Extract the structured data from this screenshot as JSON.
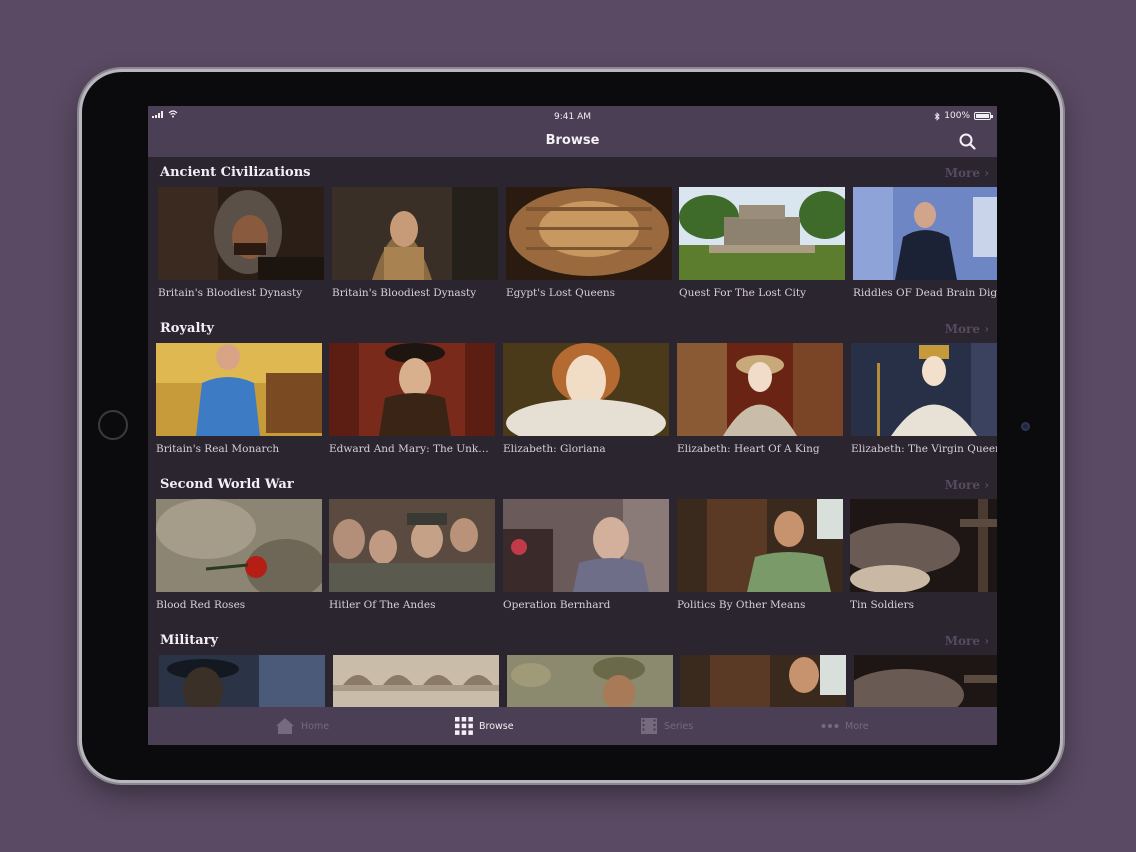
{
  "status": {
    "time": "9:41 AM",
    "battery": "100%"
  },
  "nav": {
    "title": "Browse"
  },
  "sections": [
    {
      "title": "Ancient Civilizations",
      "more": "More",
      "items": [
        "Britain's Bloodiest Dynasty",
        "Britain's Bloodiest Dynasty",
        "Egypt's Lost Queens",
        "Quest For The Lost City",
        "Riddles OF Dead Brain Digg"
      ]
    },
    {
      "title": "Royalty",
      "more": "More",
      "items": [
        "Britain's Real Monarch",
        "Edward And Mary: The Unkno...",
        "Elizabeth: Gloriana",
        "Elizabeth: Heart Of A King",
        "Elizabeth: The Virgin Queen"
      ]
    },
    {
      "title": "Second World War",
      "more": "More",
      "items": [
        "Blood Red Roses",
        "Hitler Of The Andes",
        "Operation Bernhard",
        "Politics By Other Means",
        "Tin Soldiers"
      ]
    },
    {
      "title": "Military",
      "more": "More",
      "items": []
    }
  ],
  "tabs": [
    {
      "label": "Home",
      "icon": "home-icon",
      "active": false
    },
    {
      "label": "Browse",
      "icon": "grid-icon",
      "active": true
    },
    {
      "label": "Series",
      "icon": "film-icon",
      "active": false
    },
    {
      "label": "More",
      "icon": "ellipsis-icon",
      "active": false
    }
  ],
  "colors": {
    "background": "#5a4a63",
    "bar": "#4b3f55",
    "content": "#2b2530",
    "more_text": "#564b5e"
  }
}
